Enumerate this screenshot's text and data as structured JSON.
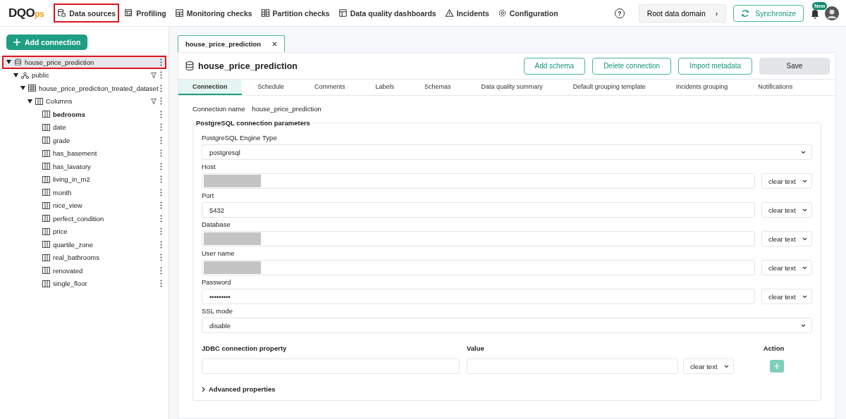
{
  "logo": {
    "text": "DQO",
    "suffix": "ps"
  },
  "nav": [
    {
      "label": "Data sources",
      "selected": true
    },
    {
      "label": "Profiling",
      "selected": false
    },
    {
      "label": "Monitoring checks",
      "selected": false
    },
    {
      "label": "Partition checks",
      "selected": false
    },
    {
      "label": "Data quality dashboards",
      "selected": false
    },
    {
      "label": "Incidents",
      "selected": false
    },
    {
      "label": "Configuration",
      "selected": false
    }
  ],
  "header_right": {
    "help": "?",
    "domain": "Root data domain",
    "domain_arrow": "›",
    "sync": "Synchronize",
    "badge": "New"
  },
  "sidebar": {
    "add_button": "Add connection",
    "tree": [
      {
        "label": "house_price_prediction",
        "kind": "connection",
        "selected": true,
        "expanded": true,
        "filter": false,
        "bold": false,
        "children": [
          {
            "label": "public",
            "kind": "schema",
            "selected": false,
            "expanded": true,
            "filter": true,
            "bold": false,
            "children": [
              {
                "label": "house_price_prediction_treated_dataset",
                "kind": "table",
                "selected": false,
                "expanded": true,
                "filter": false,
                "bold": false,
                "children": [
                  {
                    "label": "Columns",
                    "kind": "columns",
                    "selected": false,
                    "expanded": true,
                    "filter": true,
                    "bold": false,
                    "children": [
                      {
                        "label": "bedrooms",
                        "kind": "column",
                        "selected": false,
                        "bold": true
                      },
                      {
                        "label": "date",
                        "kind": "column",
                        "selected": false,
                        "bold": false
                      },
                      {
                        "label": "grade",
                        "kind": "column",
                        "selected": false,
                        "bold": false
                      },
                      {
                        "label": "has_basement",
                        "kind": "column",
                        "selected": false,
                        "bold": false
                      },
                      {
                        "label": "has_lavatory",
                        "kind": "column",
                        "selected": false,
                        "bold": false
                      },
                      {
                        "label": "living_in_m2",
                        "kind": "column",
                        "selected": false,
                        "bold": false
                      },
                      {
                        "label": "month",
                        "kind": "column",
                        "selected": false,
                        "bold": false
                      },
                      {
                        "label": "nice_view",
                        "kind": "column",
                        "selected": false,
                        "bold": false
                      },
                      {
                        "label": "perfect_condition",
                        "kind": "column",
                        "selected": false,
                        "bold": false
                      },
                      {
                        "label": "price",
                        "kind": "column",
                        "selected": false,
                        "bold": false
                      },
                      {
                        "label": "quartile_zone",
                        "kind": "column",
                        "selected": false,
                        "bold": false
                      },
                      {
                        "label": "real_bathrooms",
                        "kind": "column",
                        "selected": false,
                        "bold": false
                      },
                      {
                        "label": "renovated",
                        "kind": "column",
                        "selected": false,
                        "bold": false
                      },
                      {
                        "label": "single_floor",
                        "kind": "column",
                        "selected": false,
                        "bold": false
                      }
                    ]
                  }
                ]
              }
            ]
          }
        ]
      }
    ]
  },
  "editor_tabs": [
    {
      "label": "house_price_prediction",
      "selected": true
    }
  ],
  "editor": {
    "title": "house_price_prediction",
    "buttons": [
      "Add schema",
      "Delete connection",
      "Import metadata"
    ],
    "save": {
      "label": "Save",
      "disabled": true
    },
    "tabs": [
      {
        "label": "Connection",
        "selected": true
      },
      {
        "label": "Schedule",
        "selected": false
      },
      {
        "label": "Comments",
        "selected": false
      },
      {
        "label": "Labels",
        "selected": false
      },
      {
        "label": "Schemas",
        "selected": false
      },
      {
        "label": "Data quality summary",
        "selected": false
      },
      {
        "label": "Default grouping template",
        "selected": false
      },
      {
        "label": "Incidents grouping",
        "selected": false
      },
      {
        "label": "Notifications",
        "selected": false
      }
    ],
    "connection_name": {
      "label": "Connection name",
      "value": "house_price_prediction"
    },
    "section_title": "PostgreSQL connection parameters",
    "fields": [
      {
        "kind": "select",
        "label": "PostgreSQL Engine Type",
        "value": "postgresql"
      },
      {
        "kind": "text",
        "label": "Host",
        "redacted": true,
        "mode": "clear text"
      },
      {
        "kind": "text",
        "label": "Port",
        "value": "5432",
        "redacted": false,
        "mode": "clear text"
      },
      {
        "kind": "text",
        "label": "Database",
        "redacted": true,
        "mode": "clear text"
      },
      {
        "kind": "text",
        "label": "User name",
        "redacted": true,
        "mode": "clear text"
      },
      {
        "kind": "text",
        "label": "Password",
        "value": "•••••••••",
        "redacted": false,
        "mode": "clear text"
      },
      {
        "kind": "select",
        "label": "SSL mode",
        "value": "disable"
      }
    ],
    "jdbc": {
      "columns": [
        "JDBC connection property",
        "Value",
        "Action"
      ],
      "mode": "clear text"
    },
    "advanced": {
      "label": "Advanced properties",
      "expanded": false
    }
  }
}
